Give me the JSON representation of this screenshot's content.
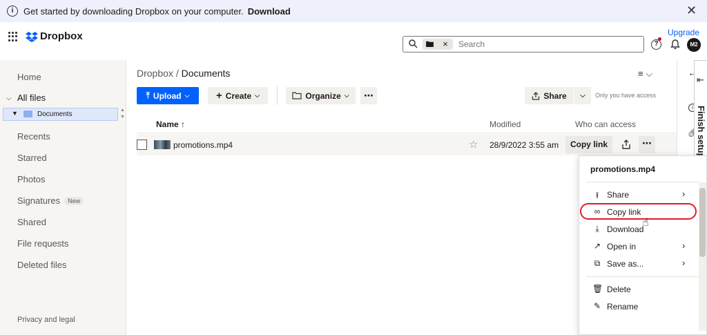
{
  "banner": {
    "message": "Get started by downloading Dropbox on your computer.",
    "link": "Download",
    "close": "✕"
  },
  "header": {
    "brand": "Dropbox",
    "search_placeholder": "Search",
    "search_chip_clear": "×",
    "upgrade": "Upgrade",
    "avatar_initials": "M2"
  },
  "sidebar": {
    "items": [
      {
        "label": "Home"
      },
      {
        "label": "All files"
      },
      {
        "label": "Recents"
      },
      {
        "label": "Starred"
      },
      {
        "label": "Photos"
      },
      {
        "label": "Signatures",
        "badge": "New"
      },
      {
        "label": "Shared"
      },
      {
        "label": "File requests"
      },
      {
        "label": "Deleted files"
      }
    ],
    "subfolder": "Documents",
    "footer": "Privacy and legal"
  },
  "main": {
    "breadcrumb_root": "Dropbox",
    "breadcrumb_sep": "/",
    "breadcrumb_current": "Documents",
    "toolbar": {
      "upload": "Upload",
      "create": "Create",
      "organize": "Organize",
      "share": "Share",
      "access_note": "Only you have access"
    },
    "columns": {
      "name": "Name",
      "modified": "Modified",
      "access": "Who can access"
    },
    "rows": [
      {
        "name": "promotions.mp4",
        "modified": "28/9/2022 3:55 am",
        "action": "Copy link"
      }
    ]
  },
  "right_panel": {
    "tab_label": "Finish setup"
  },
  "context_menu": {
    "title": "promotions.mp4",
    "items": [
      {
        "label": "Share",
        "icon": "share-icon",
        "submenu": true
      },
      {
        "label": "Copy link",
        "icon": "link-icon",
        "submenu": false
      },
      {
        "label": "Download",
        "icon": "download-icon",
        "submenu": false
      },
      {
        "label": "Open in",
        "icon": "open-external-icon",
        "submenu": true
      },
      {
        "label": "Save as...",
        "icon": "save-as-icon",
        "submenu": true
      },
      {
        "label": "Delete",
        "icon": "trash-icon",
        "submenu": false
      },
      {
        "label": "Rename",
        "icon": "rename-icon",
        "submenu": false
      }
    ]
  },
  "colors": {
    "accent": "#0061fe",
    "highlight": "#e01b24",
    "sidebar_bg": "#f7f5f2"
  }
}
